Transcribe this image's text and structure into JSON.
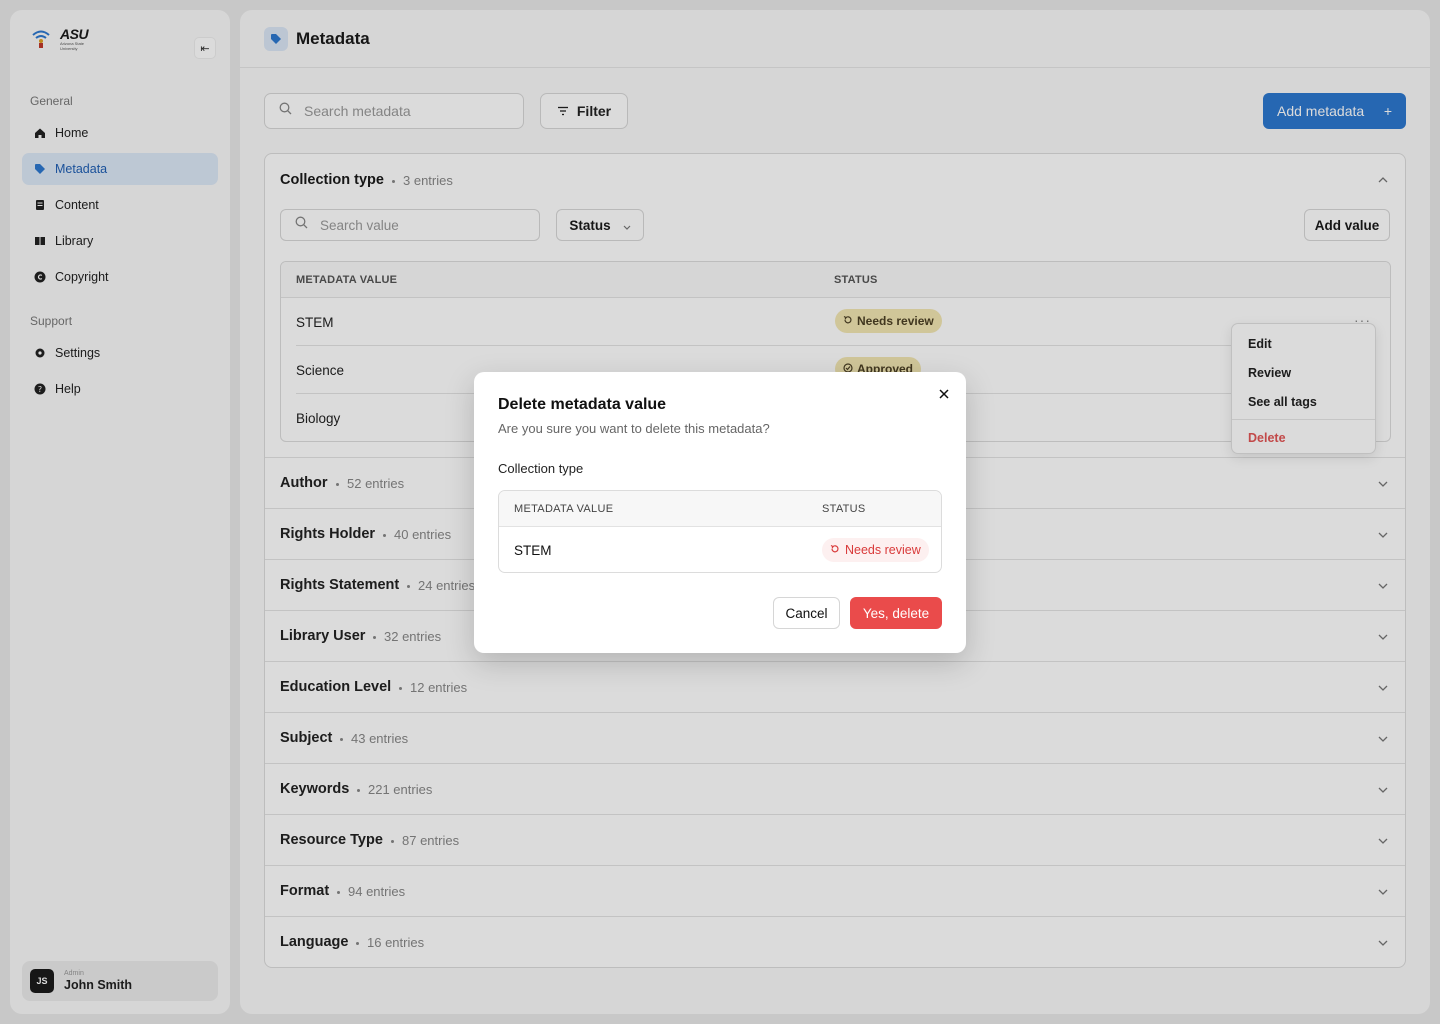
{
  "colors": {
    "accent": "#2d78d0",
    "danger": "#ea4b4b",
    "needs_review_bg": "#f3e7b3",
    "active_nav_bg": "#dde9f7"
  },
  "sidebar": {
    "logo": {
      "text": "ASU",
      "subtext": "Arizona State University"
    },
    "sections": [
      {
        "title": "General"
      },
      {
        "title": "Support"
      }
    ],
    "items": [
      {
        "label": "Home",
        "icon": "home-icon"
      },
      {
        "label": "Metadata",
        "icon": "tag-icon",
        "active": true
      },
      {
        "label": "Content",
        "icon": "file-icon"
      },
      {
        "label": "Library",
        "icon": "book-icon"
      },
      {
        "label": "Copyright",
        "icon": "copyright-icon"
      },
      {
        "label": "Settings",
        "icon": "gear-icon"
      },
      {
        "label": "Help",
        "icon": "help-icon"
      }
    ],
    "user": {
      "initials": "JS",
      "role": "Admin",
      "name": "John Smith"
    }
  },
  "header": {
    "title": "Metadata"
  },
  "toolbar": {
    "search_placeholder": "Search metadata",
    "filter_label": "Filter",
    "add_label": "Add metadata",
    "add_icon": "+"
  },
  "expanded": {
    "title": "Collection type",
    "count": "3 entries",
    "search_placeholder": "Search value",
    "status_label": "Status",
    "add_value_label": "Add value",
    "columns": [
      "METADATA VALUE",
      "STATUS"
    ],
    "rows": [
      {
        "value": "STEM",
        "status": "Needs review"
      },
      {
        "value": "Science",
        "status": "Approved"
      },
      {
        "value": "Biology",
        "status": ""
      }
    ]
  },
  "context_menu": {
    "items": [
      "Edit",
      "Review",
      "See all tags"
    ],
    "danger_item": "Delete"
  },
  "collapsed": [
    {
      "title": "Author",
      "count": "52 entries"
    },
    {
      "title": "Rights Holder",
      "count": "40 entries"
    },
    {
      "title": "Rights Statement",
      "count": "24 entries"
    },
    {
      "title": "Library User",
      "count": "32 entries"
    },
    {
      "title": "Education Level",
      "count": "12 entries"
    },
    {
      "title": "Subject",
      "count": "43 entries"
    },
    {
      "title": "Keywords",
      "count": "221 entries"
    },
    {
      "title": "Resource Type",
      "count": "87 entries"
    },
    {
      "title": "Format",
      "count": "94 entries"
    },
    {
      "title": "Language",
      "count": "16 entries"
    }
  ],
  "modal": {
    "title": "Delete metadata value",
    "subtitle": "Are you sure you want to delete this metadata?",
    "group": "Collection type",
    "columns": [
      "METADATA VALUE",
      "STATUS"
    ],
    "row": {
      "value": "STEM",
      "status": "Needs review"
    },
    "cancel_label": "Cancel",
    "confirm_label": "Yes, delete"
  }
}
